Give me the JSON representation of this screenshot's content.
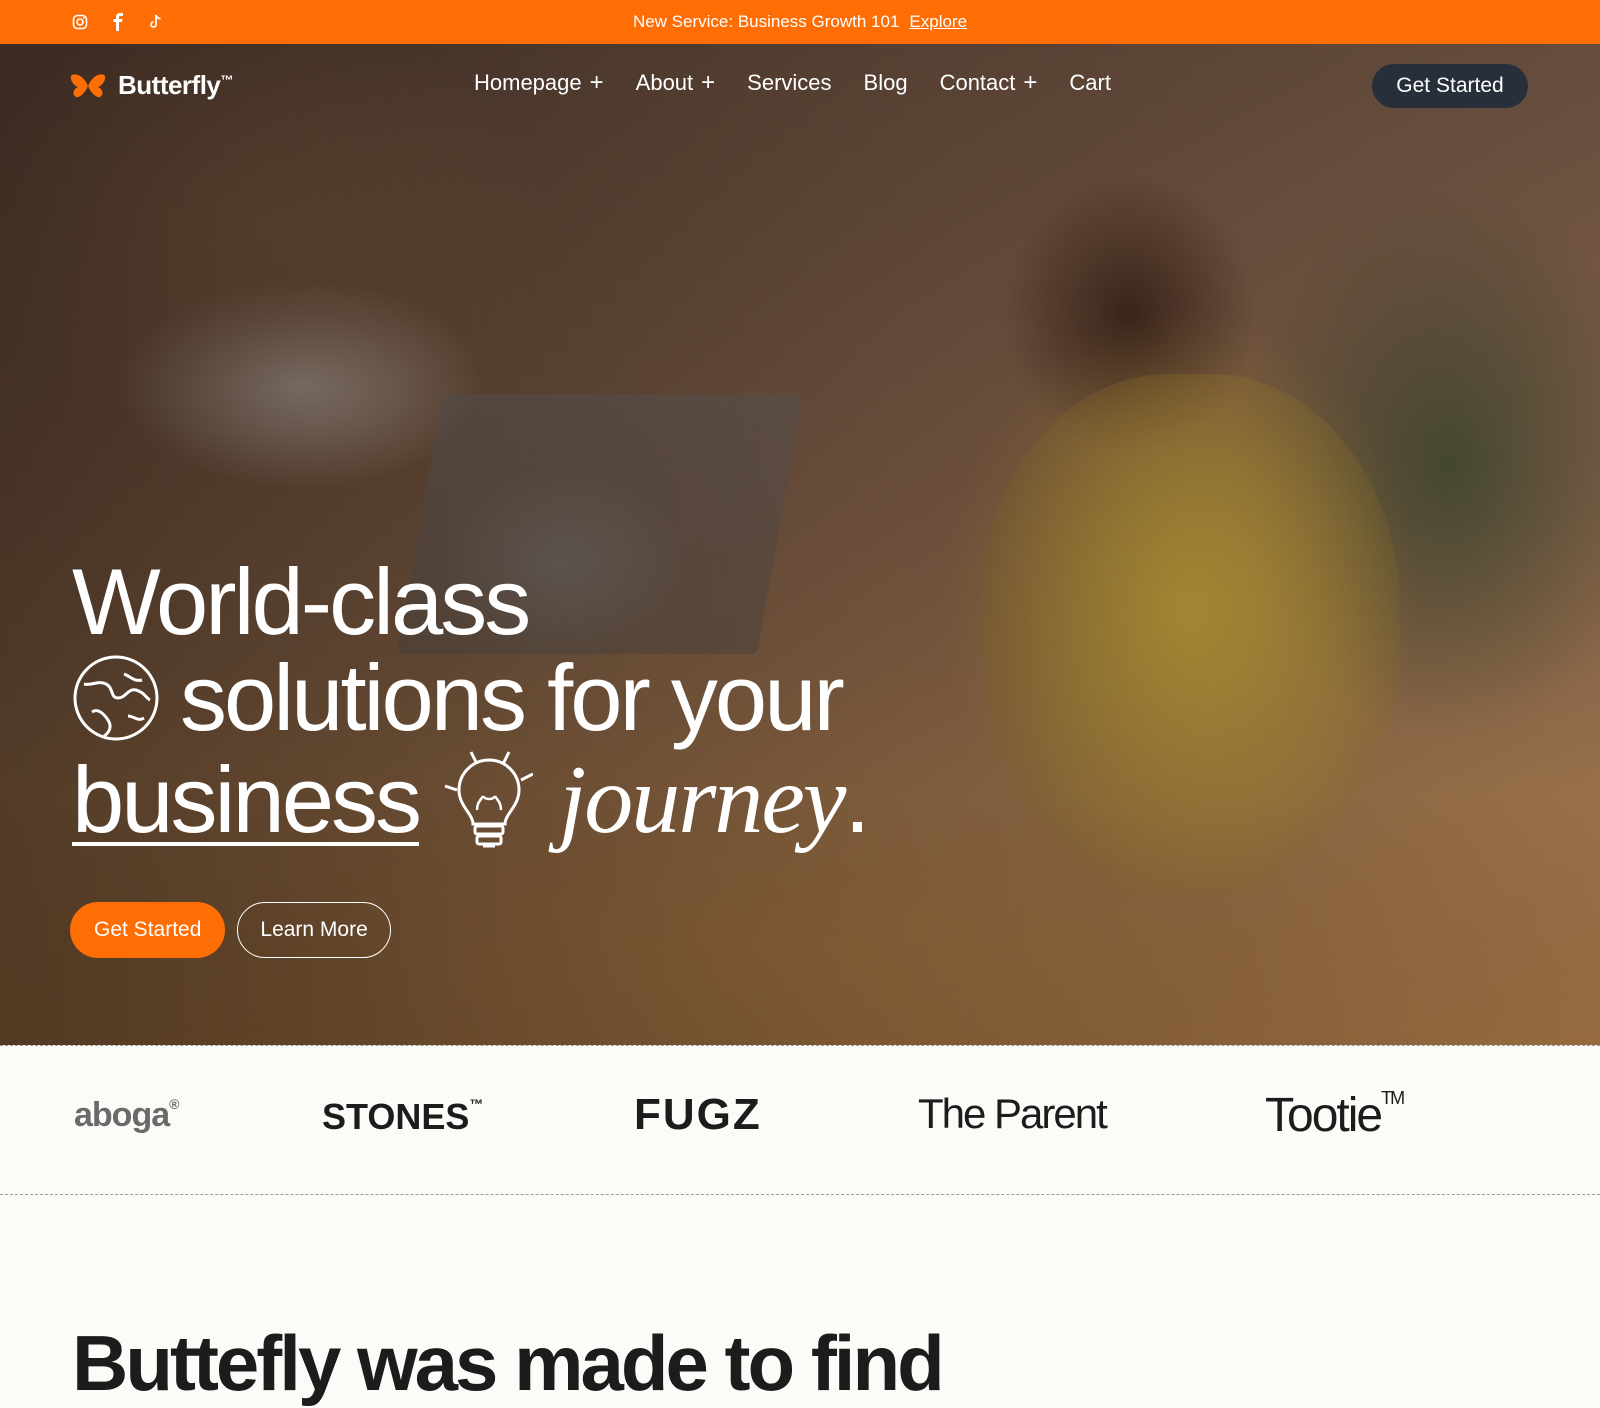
{
  "announcement": {
    "text": "New Service: Business Growth 101",
    "link": "Explore",
    "socials": [
      "instagram-icon",
      "facebook-icon",
      "tiktok-icon"
    ]
  },
  "nav": {
    "brand": "Butterfly",
    "trademark": "™",
    "items": [
      {
        "label": "Homepage",
        "has_submenu": true
      },
      {
        "label": "About",
        "has_submenu": true
      },
      {
        "label": "Services",
        "has_submenu": false
      },
      {
        "label": "Blog",
        "has_submenu": false
      },
      {
        "label": "Contact",
        "has_submenu": true
      },
      {
        "label": "Cart",
        "has_submenu": false
      }
    ],
    "plus": "+",
    "cta": "Get Started"
  },
  "hero": {
    "line1": "World-class",
    "line2": "solutions for your",
    "line3_word": "business",
    "line3_italic": "journey",
    "line3_period": ".",
    "primary_button": "Get Started",
    "secondary_button": "Learn More"
  },
  "partners": [
    {
      "name": "aboga",
      "mark": "®"
    },
    {
      "name": "STONES",
      "mark": "™"
    },
    {
      "name": "FUGZ",
      "mark": ""
    },
    {
      "name": "The Parent",
      "mark": ""
    },
    {
      "name": "Tootie",
      "mark": "TM"
    }
  ],
  "intro": {
    "heading": "Buttefly was made to find"
  },
  "colors": {
    "accent": "#ff6d05",
    "dark_button": "#27303a",
    "background": "#fbfbf8"
  }
}
